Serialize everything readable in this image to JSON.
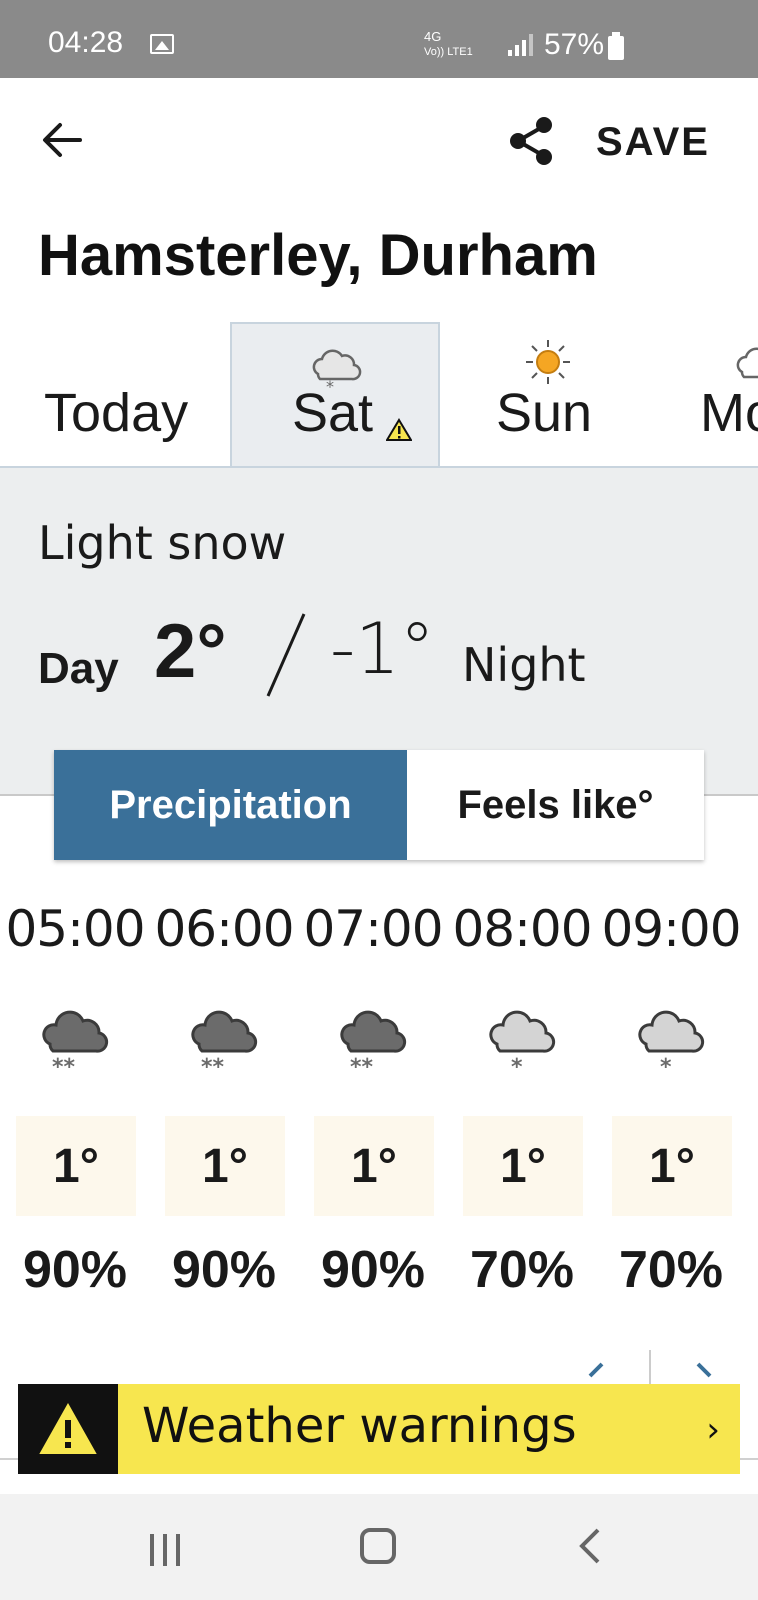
{
  "status_bar": {
    "time": "04:28",
    "network": "4G",
    "volte": "Vo)) LTE1",
    "battery": "57%"
  },
  "app_bar": {
    "back_icon": "arrow-left-icon",
    "share_icon": "share-icon",
    "save_label": "SAVE"
  },
  "location": "Hamsterley, Durham",
  "day_tabs": [
    {
      "label": "Today",
      "icon": "",
      "selected": false
    },
    {
      "label": "Sat",
      "icon": "light-snow-icon",
      "selected": true,
      "warning": true
    },
    {
      "label": "Sun",
      "icon": "sunny-icon",
      "selected": false
    },
    {
      "label": "Mo",
      "icon": "cloud-icon",
      "selected": false
    }
  ],
  "summary": {
    "condition": "Light snow",
    "day_label": "Day",
    "day_temp": "2°",
    "night_temp": "-1°",
    "night_label": "Night"
  },
  "toggle": {
    "precipitation": "Precipitation",
    "feels_like": "Feels like°",
    "selected": "precipitation"
  },
  "hourly": [
    {
      "time": "05:00",
      "icon": "heavy-snow-icon",
      "temp": "1°",
      "precip": "90%"
    },
    {
      "time": "06:00",
      "icon": "heavy-snow-icon",
      "temp": "1°",
      "precip": "90%"
    },
    {
      "time": "07:00",
      "icon": "heavy-snow-icon",
      "temp": "1°",
      "precip": "90%"
    },
    {
      "time": "08:00",
      "icon": "light-snow-icon",
      "temp": "1°",
      "precip": "70%"
    },
    {
      "time": "09:00",
      "icon": "light-snow-icon",
      "temp": "1°",
      "precip": "70%"
    }
  ],
  "warnings": {
    "label": "Weather warnings",
    "chevron": "›"
  },
  "colors": {
    "accent": "#3a7099",
    "warning_yellow": "#f7e64f",
    "summary_bg": "#eceeef",
    "temp_bg": "#fdf8ec"
  }
}
